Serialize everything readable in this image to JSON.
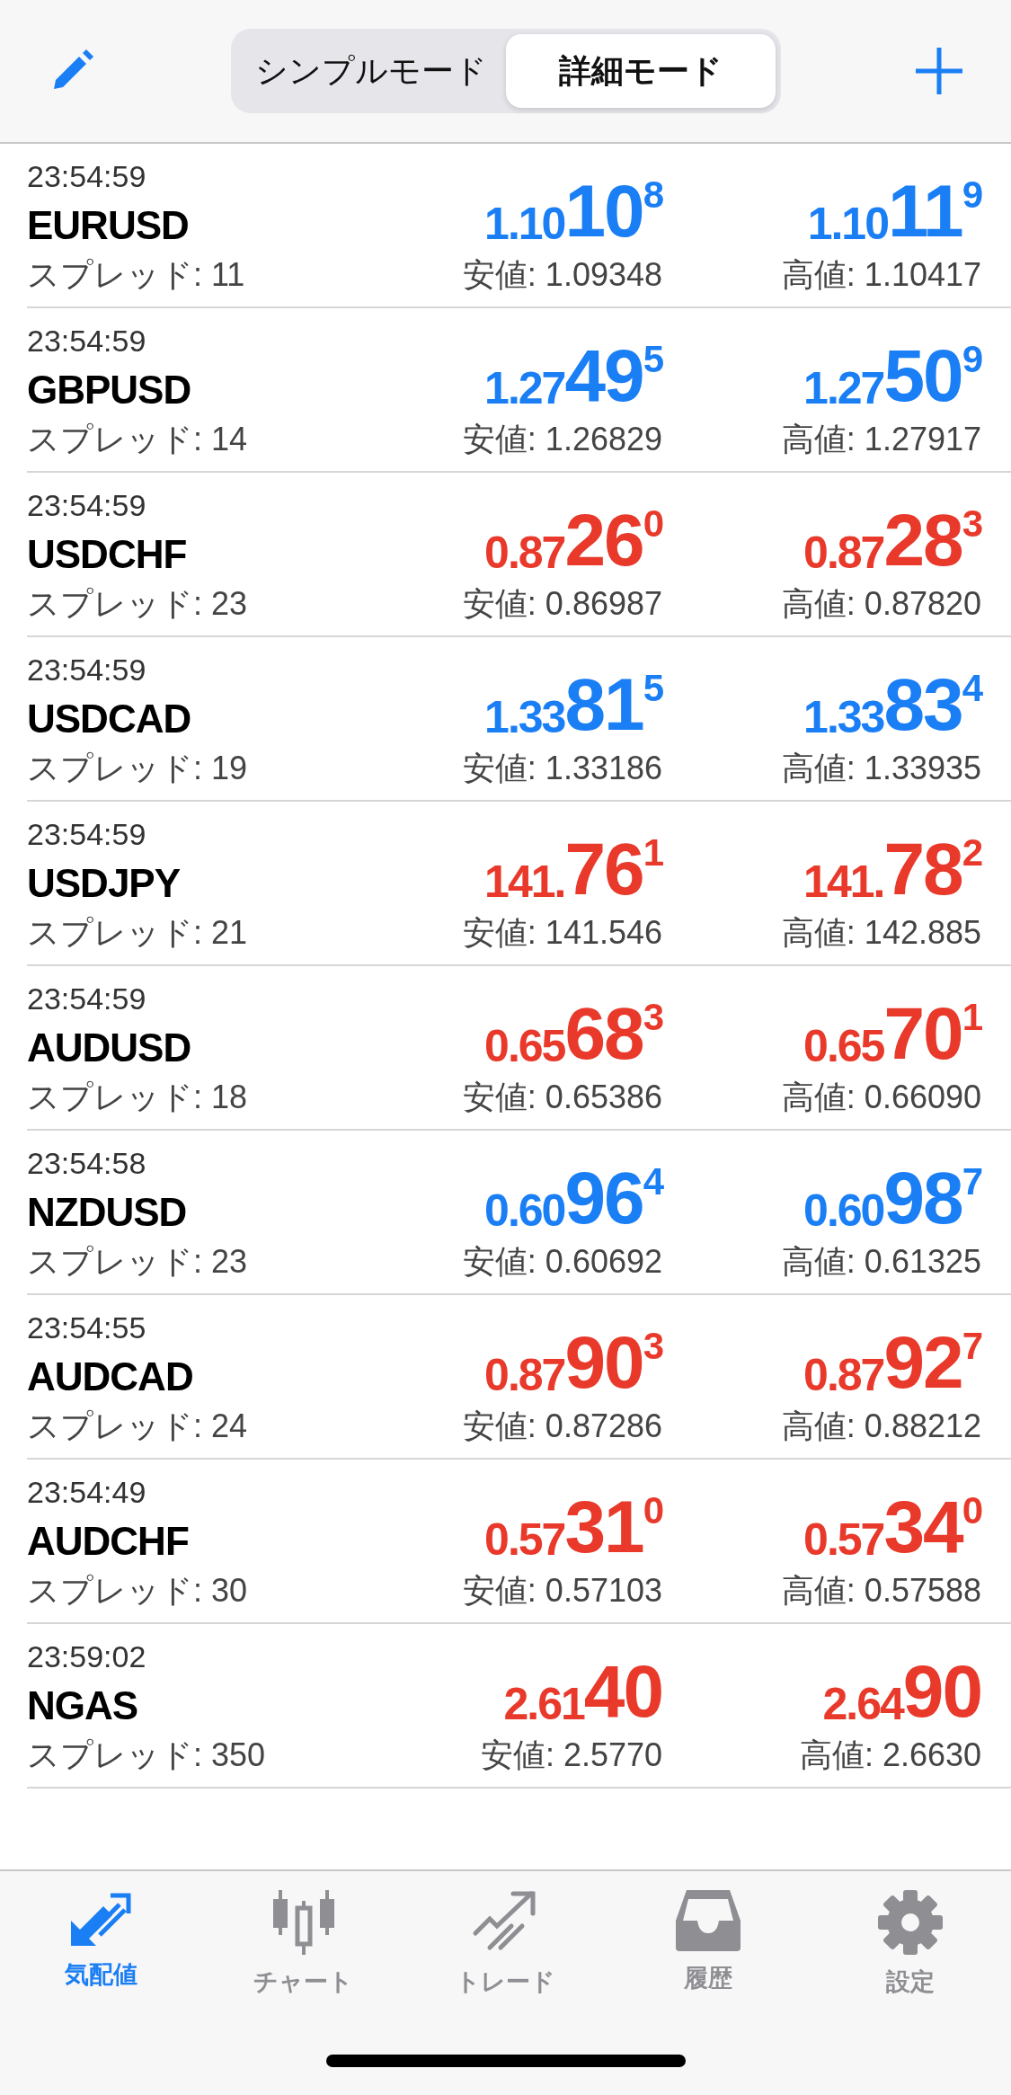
{
  "header": {
    "segments": [
      {
        "label": "シンプルモード",
        "selected": false
      },
      {
        "label": "詳細モード",
        "selected": true
      }
    ]
  },
  "quotes": [
    {
      "time": "23:54:59",
      "symbol": "EURUSD",
      "spread": "スプレッド: 11",
      "color": "#1a7ef5",
      "bid": {
        "prefix": "1.10",
        "big": "10",
        "sup": "8"
      },
      "ask": {
        "prefix": "1.10",
        "big": "11",
        "sup": "9"
      },
      "low": "安値: 1.09348",
      "high": "高値: 1.10417"
    },
    {
      "time": "23:54:59",
      "symbol": "GBPUSD",
      "spread": "スプレッド: 14",
      "color": "#1a7ef5",
      "bid": {
        "prefix": "1.27",
        "big": "49",
        "sup": "5"
      },
      "ask": {
        "prefix": "1.27",
        "big": "50",
        "sup": "9"
      },
      "low": "安値: 1.26829",
      "high": "高値: 1.27917"
    },
    {
      "time": "23:54:59",
      "symbol": "USDCHF",
      "spread": "スプレッド: 23",
      "color": "#e8392b",
      "bid": {
        "prefix": "0.87",
        "big": "26",
        "sup": "0"
      },
      "ask": {
        "prefix": "0.87",
        "big": "28",
        "sup": "3"
      },
      "low": "安値: 0.86987",
      "high": "高値: 0.87820"
    },
    {
      "time": "23:54:59",
      "symbol": "USDCAD",
      "spread": "スプレッド: 19",
      "color": "#1a7ef5",
      "bid": {
        "prefix": "1.33",
        "big": "81",
        "sup": "5"
      },
      "ask": {
        "prefix": "1.33",
        "big": "83",
        "sup": "4"
      },
      "low": "安値: 1.33186",
      "high": "高値: 1.33935"
    },
    {
      "time": "23:54:59",
      "symbol": "USDJPY",
      "spread": "スプレッド: 21",
      "color": "#e8392b",
      "bid": {
        "prefix": "141.",
        "big": "76",
        "sup": "1"
      },
      "ask": {
        "prefix": "141.",
        "big": "78",
        "sup": "2"
      },
      "low": "安値: 141.546",
      "high": "高値: 142.885"
    },
    {
      "time": "23:54:59",
      "symbol": "AUDUSD",
      "spread": "スプレッド: 18",
      "color": "#e8392b",
      "bid": {
        "prefix": "0.65",
        "big": "68",
        "sup": "3"
      },
      "ask": {
        "prefix": "0.65",
        "big": "70",
        "sup": "1"
      },
      "low": "安値: 0.65386",
      "high": "高値: 0.66090"
    },
    {
      "time": "23:54:58",
      "symbol": "NZDUSD",
      "spread": "スプレッド: 23",
      "color": "#1a7ef5",
      "bid": {
        "prefix": "0.60",
        "big": "96",
        "sup": "4"
      },
      "ask": {
        "prefix": "0.60",
        "big": "98",
        "sup": "7"
      },
      "low": "安値: 0.60692",
      "high": "高値: 0.61325"
    },
    {
      "time": "23:54:55",
      "symbol": "AUDCAD",
      "spread": "スプレッド: 24",
      "color": "#e8392b",
      "bid": {
        "prefix": "0.87",
        "big": "90",
        "sup": "3"
      },
      "ask": {
        "prefix": "0.87",
        "big": "92",
        "sup": "7"
      },
      "low": "安値: 0.87286",
      "high": "高値: 0.88212"
    },
    {
      "time": "23:54:49",
      "symbol": "AUDCHF",
      "spread": "スプレッド: 30",
      "color": "#e8392b",
      "bid": {
        "prefix": "0.57",
        "big": "31",
        "sup": "0"
      },
      "ask": {
        "prefix": "0.57",
        "big": "34",
        "sup": "0"
      },
      "low": "安値: 0.57103",
      "high": "高値: 0.57588"
    },
    {
      "time": "23:59:02",
      "symbol": "NGAS",
      "spread": "スプレッド: 350",
      "color": "#e8392b",
      "bid": {
        "prefix": "2.61",
        "big": "40"
      },
      "ask": {
        "prefix": "2.64",
        "big": "90"
      },
      "low": "安値: 2.5770",
      "high": "高値: 2.6630"
    }
  ],
  "tab_bar": [
    {
      "label": "気配値",
      "selected": true,
      "kind": "quotes"
    },
    {
      "label": "チャート",
      "selected": false,
      "kind": "chart"
    },
    {
      "label": "トレード",
      "selected": false,
      "kind": "trade"
    },
    {
      "label": "履歴",
      "selected": false,
      "kind": "history"
    },
    {
      "label": "設定",
      "selected": false,
      "kind": "settings"
    }
  ]
}
